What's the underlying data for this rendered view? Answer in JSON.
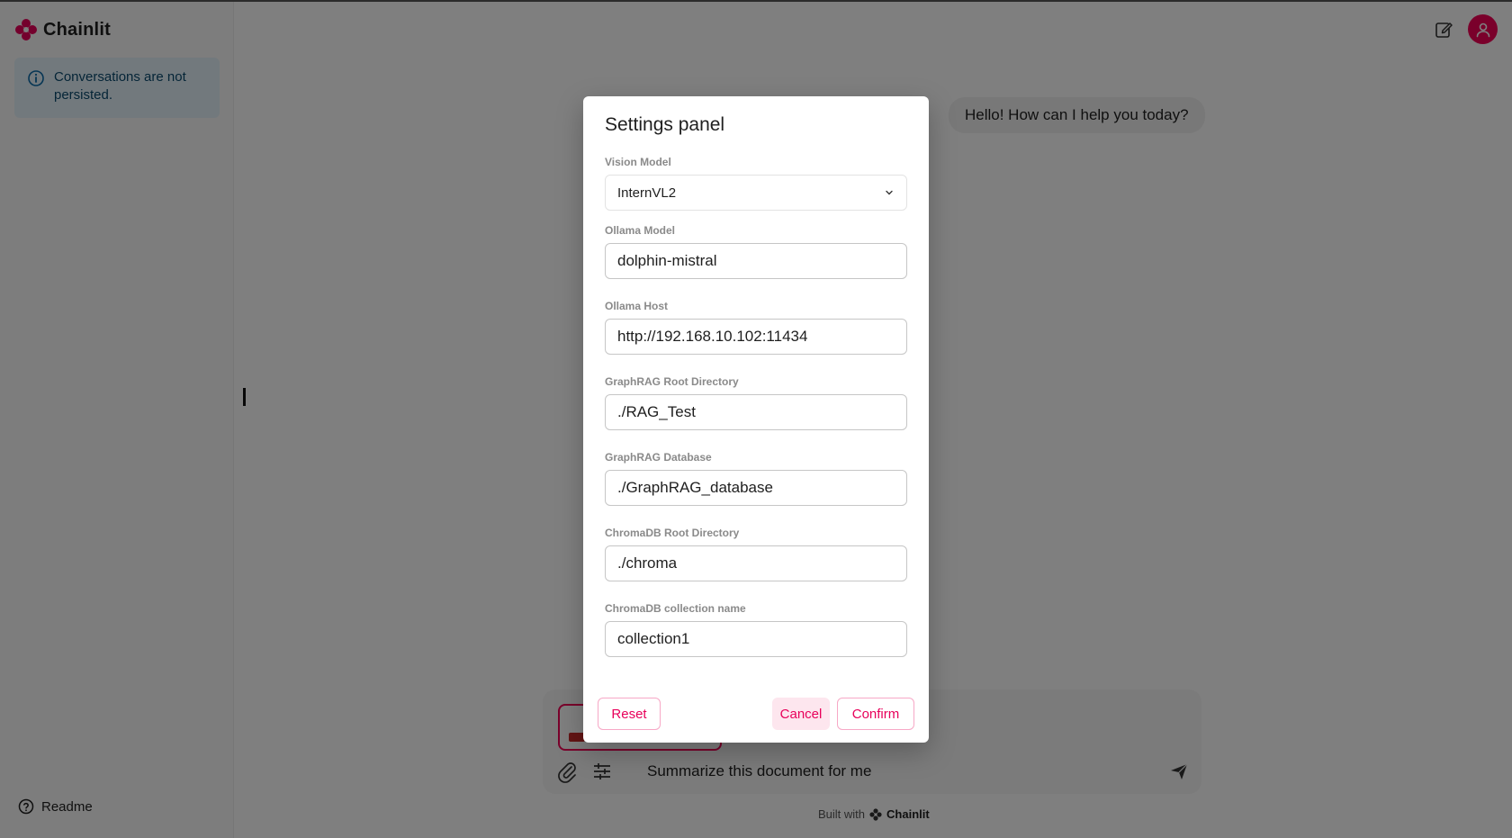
{
  "app": {
    "name": "Chainlit"
  },
  "sidebar": {
    "notice": "Conversations are not persisted.",
    "readme_label": "Readme"
  },
  "chat": {
    "assistant_message": "Hello! How can I help you today?"
  },
  "composer": {
    "input_value": "Summarize this document for me"
  },
  "footer": {
    "built_with": "Built with",
    "brand": "Chainlit"
  },
  "settings": {
    "title": "Settings panel",
    "fields": [
      {
        "label": "Vision Model",
        "value": "InternVL2",
        "type": "select"
      },
      {
        "label": "Ollama Model",
        "value": "dolphin-mistral",
        "type": "text"
      },
      {
        "label": "Ollama Host",
        "value": "http://192.168.10.102:11434",
        "type": "text"
      },
      {
        "label": "GraphRAG Root Directory",
        "value": "./RAG_Test",
        "type": "text"
      },
      {
        "label": "GraphRAG Database",
        "value": "./GraphRAG_database",
        "type": "text"
      },
      {
        "label": "ChromaDB Root Directory",
        "value": "./chroma",
        "type": "text"
      },
      {
        "label": "ChromaDB collection name",
        "value": "collection1",
        "type": "text"
      }
    ],
    "buttons": {
      "reset": "Reset",
      "cancel": "Cancel",
      "confirm": "Confirm"
    }
  },
  "colors": {
    "accent": "#f50057",
    "notice_bg": "#e5f3fb",
    "notice_text": "#0b4a6f"
  },
  "icons": {
    "brand": "chainlit-logo-icon",
    "info": "info-icon",
    "new_chat": "edit-icon",
    "user": "user-icon",
    "attach": "paperclip-icon",
    "settings": "sliders-icon",
    "send": "send-icon",
    "help": "help-circle-icon",
    "dropdown": "chevron-down-icon"
  }
}
